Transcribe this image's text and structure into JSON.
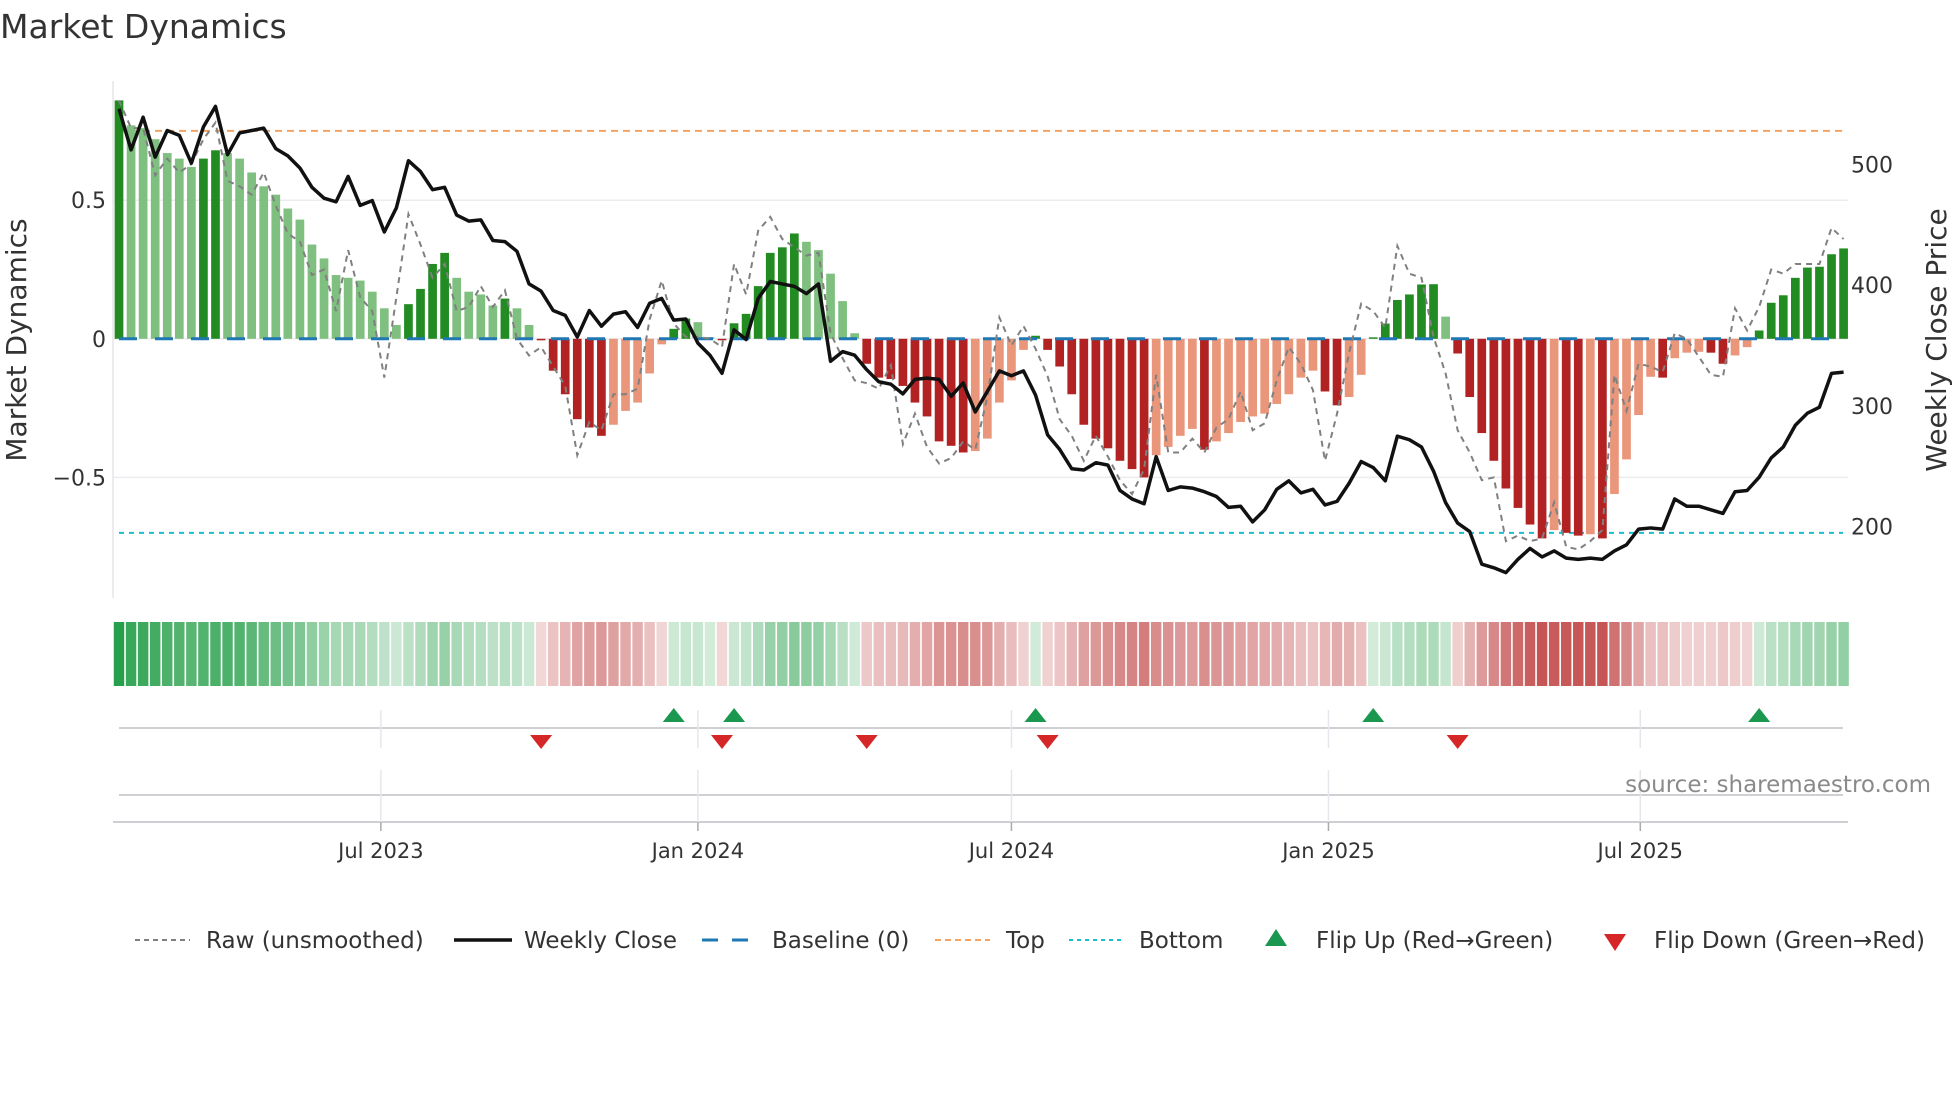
{
  "title": "Market Dynamics",
  "source": "source: sharemaestro.com",
  "chart_data": {
    "type": "bar",
    "title": "Market Dynamics",
    "ylabel": "Market Dynamics",
    "ylabel_right": "Weekly Close Price",
    "start_date": "2023-01-30",
    "frequency": "weekly",
    "ylim": [
      -0.935,
      0.93
    ],
    "ylim_right": [
      141,
      569
    ],
    "yticks": [
      {
        "value": 0.5,
        "label": "0.5"
      },
      {
        "value": 0,
        "label": "0"
      },
      {
        "value": -0.5,
        "label": "−0.5"
      }
    ],
    "yticks_right": [
      {
        "value": 500,
        "label": "500"
      },
      {
        "value": 400,
        "label": "400"
      },
      {
        "value": 300,
        "label": "300"
      },
      {
        "value": 200,
        "label": "200"
      }
    ],
    "xticks": [
      {
        "date": "2023-07-01",
        "label": "Jul 2023"
      },
      {
        "date": "2024-01-01",
        "label": "Jan 2024"
      },
      {
        "date": "2024-07-01",
        "label": "Jul 2024"
      },
      {
        "date": "2025-01-01",
        "label": "Jan 2025"
      },
      {
        "date": "2025-07-01",
        "label": "Jul 2025"
      }
    ],
    "top_level": 0.75,
    "bottom_level": -0.7,
    "baseline": 0,
    "grid": true,
    "legend_position": "bottom",
    "colors": {
      "up_strong": "#228b22",
      "up_weak": "#7fbf7f",
      "down_strong": "#b22222",
      "down_weak": "#e9967a",
      "raw": "#808080",
      "close": "#111111",
      "baseline": "#1f77b4",
      "top": "#f4a460",
      "bottom": "#17becf",
      "flip_up": "#1a9850",
      "flip_down": "#d62728",
      "heat_green": "#28a04b",
      "heat_red": "#be3c3c"
    },
    "dynamics": [
      0.86,
      0.77,
      0.76,
      0.72,
      0.67,
      0.65,
      0.62,
      0.65,
      0.68,
      0.67,
      0.65,
      0.6,
      0.55,
      0.52,
      0.47,
      0.43,
      0.34,
      0.29,
      0.23,
      0.22,
      0.21,
      0.17,
      0.11,
      0.05,
      0.125,
      0.18,
      0.27,
      0.31,
      0.22,
      0.17,
      0.16,
      0.12,
      0.145,
      0.11,
      0.05,
      -0.005,
      -0.115,
      -0.2,
      -0.29,
      -0.32,
      -0.35,
      -0.31,
      -0.26,
      -0.23,
      -0.125,
      -0.02,
      0.036,
      0.073,
      0.06,
      0.005,
      -0.005,
      0.056,
      0.09,
      0.19,
      0.31,
      0.33,
      0.38,
      0.35,
      0.32,
      0.235,
      0.136,
      0.02,
      -0.09,
      -0.14,
      -0.145,
      -0.17,
      -0.23,
      -0.28,
      -0.37,
      -0.386,
      -0.41,
      -0.405,
      -0.36,
      -0.23,
      -0.15,
      -0.04,
      0.011,
      -0.04,
      -0.1,
      -0.2,
      -0.31,
      -0.36,
      -0.395,
      -0.44,
      -0.47,
      -0.5,
      -0.42,
      -0.39,
      -0.35,
      -0.325,
      -0.4,
      -0.37,
      -0.34,
      -0.3,
      -0.28,
      -0.27,
      -0.235,
      -0.2,
      -0.14,
      -0.115,
      -0.19,
      -0.24,
      -0.21,
      -0.13,
      0.005,
      0.055,
      0.14,
      0.16,
      0.196,
      0.197,
      0.08,
      -0.053,
      -0.21,
      -0.34,
      -0.44,
      -0.54,
      -0.61,
      -0.67,
      -0.72,
      -0.69,
      -0.7,
      -0.71,
      -0.705,
      -0.72,
      -0.56,
      -0.435,
      -0.275,
      -0.137,
      -0.14,
      -0.07,
      -0.05,
      -0.047,
      -0.05,
      -0.09,
      -0.06,
      -0.03,
      0.03,
      0.13,
      0.157,
      0.22,
      0.257,
      0.26,
      0.305,
      0.326
    ],
    "raw": [
      0.86,
      0.76,
      0.76,
      0.59,
      0.65,
      0.6,
      0.63,
      0.72,
      0.78,
      0.57,
      0.55,
      0.52,
      0.6,
      0.48,
      0.38,
      0.35,
      0.23,
      0.25,
      0.1,
      0.32,
      0.15,
      0.1,
      -0.14,
      0.15,
      0.45,
      0.34,
      0.22,
      0.27,
      0.1,
      0.115,
      0.19,
      0.115,
      0.175,
      0.0,
      -0.06,
      -0.03,
      -0.1,
      -0.17,
      -0.42,
      -0.3,
      -0.33,
      -0.2,
      -0.2,
      -0.18,
      0.07,
      0.21,
      0.055,
      0.007,
      0.007,
      0.0,
      -0.03,
      0.27,
      0.16,
      0.39,
      0.44,
      0.36,
      0.33,
      0.3,
      0.31,
      0.02,
      -0.07,
      -0.15,
      -0.16,
      -0.18,
      -0.095,
      -0.38,
      -0.27,
      -0.39,
      -0.45,
      -0.43,
      -0.37,
      -0.4,
      -0.21,
      0.077,
      -0.024,
      0.046,
      -0.036,
      -0.135,
      -0.29,
      -0.35,
      -0.44,
      -0.35,
      -0.425,
      -0.51,
      -0.56,
      -0.47,
      -0.13,
      -0.41,
      -0.41,
      -0.36,
      -0.41,
      -0.32,
      -0.29,
      -0.19,
      -0.33,
      -0.305,
      -0.15,
      -0.03,
      -0.09,
      -0.185,
      -0.44,
      -0.27,
      -0.05,
      0.127,
      0.1,
      0.04,
      0.335,
      0.235,
      0.22,
      0.007,
      -0.125,
      -0.33,
      -0.41,
      -0.51,
      -0.5,
      -0.73,
      -0.71,
      -0.73,
      -0.72,
      -0.59,
      -0.75,
      -0.76,
      -0.73,
      -0.69,
      -0.13,
      -0.26,
      -0.09,
      -0.1,
      -0.12,
      0.02,
      0.0,
      -0.065,
      -0.13,
      -0.137,
      0.11,
      0.03,
      0.115,
      0.25,
      0.235,
      0.27,
      0.27,
      0.27,
      0.4,
      0.36
    ],
    "close": [
      546,
      512,
      539,
      506,
      528,
      524,
      501,
      531,
      548,
      508,
      526,
      528,
      530,
      513,
      507,
      497,
      481,
      472,
      469,
      490,
      466,
      470,
      444,
      464,
      503,
      494,
      479,
      481,
      458,
      453,
      454,
      437,
      436,
      428,
      401,
      395,
      379,
      375,
      357,
      379,
      366,
      376,
      378,
      365,
      385,
      389,
      371,
      372,
      352,
      342,
      327,
      363,
      355,
      389,
      403,
      401,
      399,
      393,
      401,
      337,
      345,
      342,
      330,
      320,
      318,
      310,
      322,
      323,
      322,
      308,
      319,
      295,
      312,
      329,
      325,
      329,
      309,
      276,
      264,
      248,
      247,
      253,
      251,
      230,
      223,
      219,
      258,
      230,
      233,
      232,
      229,
      225,
      216,
      217,
      204,
      214,
      231,
      238,
      228,
      231,
      218,
      221,
      236,
      254,
      249,
      238,
      275,
      272,
      266,
      246,
      220,
      203,
      196,
      169,
      166,
      162,
      173,
      182,
      175,
      180,
      174,
      173,
      174,
      173,
      180,
      185,
      198,
      199,
      198,
      223,
      217,
      217,
      214,
      211,
      229,
      230,
      241,
      257,
      266,
      284,
      294,
      299,
      327,
      328
    ],
    "flip_up_weeks": [
      47,
      52,
      77,
      105,
      137
    ],
    "flip_down_weeks": [
      36,
      51,
      63,
      78,
      112
    ],
    "legend": [
      {
        "key": "raw",
        "label": "Raw (unsmoothed)"
      },
      {
        "key": "close",
        "label": "Weekly Close"
      },
      {
        "key": "baseline",
        "label": "Baseline (0)"
      },
      {
        "key": "top",
        "label": "Top"
      },
      {
        "key": "bottom",
        "label": "Bottom"
      },
      {
        "key": "flip_up",
        "label": "Flip Up (Red→Green)"
      },
      {
        "key": "flip_down",
        "label": "Flip Down (Green→Red)"
      }
    ]
  }
}
